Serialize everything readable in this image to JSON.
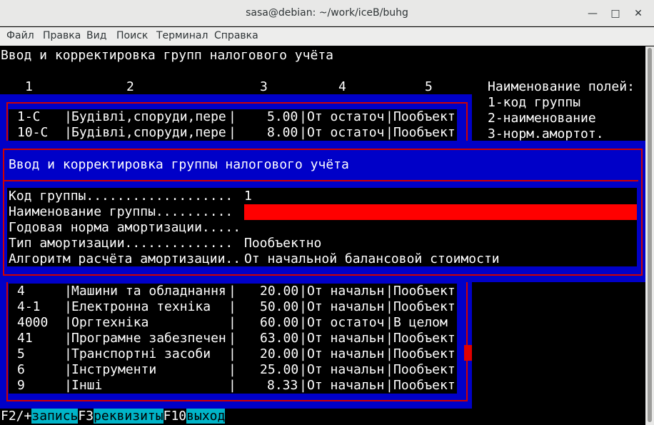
{
  "window": {
    "title": "sasa@debian: ~/work/iceB/buhg",
    "menu": [
      "Файл",
      "Правка",
      "Вид",
      "Поиск",
      "Терминал",
      "Справка"
    ]
  },
  "screen_title": "Ввод и корректировка групп налогового учёта",
  "column_numbers": [
    "1",
    "2",
    "3",
    "4",
    "5"
  ],
  "field_legend": {
    "heading": "Наименование полей:",
    "items": [
      "1-код группы",
      "2-наименование",
      "3-норм.амортот."
    ]
  },
  "table_rows_top": [
    {
      "code": "1-C",
      "name": "Будівлі,споруди,пере",
      "rate": "5.00",
      "method": "От остаточ",
      "type": "Пообъект"
    },
    {
      "code": "10-C",
      "name": "Будівлі,споруди,пере",
      "rate": "8.00",
      "method": "От остаточ",
      "type": "Пообъект"
    }
  ],
  "table_rows_bottom": [
    {
      "code": "4",
      "name": "Машини та обладнання",
      "rate": "20.00",
      "method": "От начальн",
      "type": "Пообъект"
    },
    {
      "code": "4-1",
      "name": "Електронна техніка",
      "rate": "50.00",
      "method": "От начальн",
      "type": "Пообъект"
    },
    {
      "code": "4000",
      "name": "Оргтехніка",
      "rate": "60.00",
      "method": "От остаточ",
      "type": "В целом"
    },
    {
      "code": "41",
      "name": "Програмне забезпечен",
      "rate": "63.00",
      "method": "От начальн",
      "type": "Пообъект"
    },
    {
      "code": "5",
      "name": "Транспортні засоби",
      "rate": "20.00",
      "method": "От начальн",
      "type": "Пообъект"
    },
    {
      "code": "6",
      "name": "Інструменти",
      "rate": "25.00",
      "method": "От начальн",
      "type": "Пообъект"
    },
    {
      "code": "9",
      "name": "Інші",
      "rate": "8.33",
      "method": "От начальн",
      "type": "Пообъект"
    }
  ],
  "dialog": {
    "title": "Ввод и корректировка группы налогового учёта",
    "fields": [
      {
        "label": "Код группы...................",
        "value": "1"
      },
      {
        "label": "Наименование группы..........",
        "value": ""
      },
      {
        "label": "Годовая норма амортизации.....",
        "value": ""
      },
      {
        "label": "Тип амортизации..............",
        "value": "Пообъектно"
      },
      {
        "label": "Алгоритм расчёта амортизации..",
        "value": "От начальной балансовой стоимости"
      }
    ]
  },
  "function_keys": [
    {
      "key": "F2/+",
      "label": "запись"
    },
    {
      "key": "F3",
      "label": "реквизиты"
    },
    {
      "key": "F10",
      "label": "выход"
    }
  ],
  "colors": {
    "panel_blue": "#0000c8",
    "frame_red": "#d10000",
    "input_red": "#ff0000",
    "fkey_cyan": "#00b4c8"
  }
}
